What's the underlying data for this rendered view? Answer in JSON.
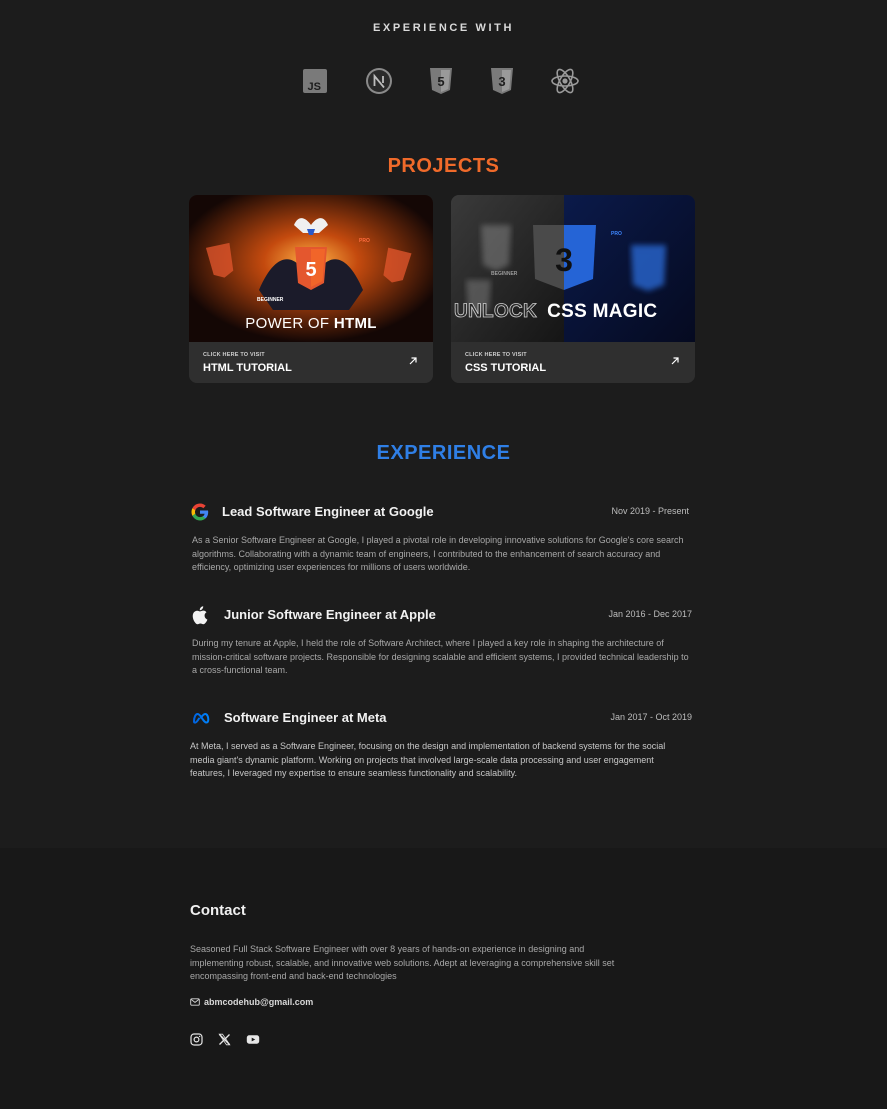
{
  "experience_with": {
    "heading": "EXPERIENCE WITH",
    "icons": [
      "javascript-icon",
      "nextjs-icon",
      "html5-icon",
      "css3-icon",
      "react-icon"
    ]
  },
  "projects": {
    "heading": "PROJECTS",
    "cards": [
      {
        "thumb_caption_a": "POWER OF ",
        "thumb_caption_b": "HTML",
        "thumb_tag_beginner": "BEGINNER",
        "thumb_tag_pro": "PRO",
        "visit_label": "CLICK HERE TO VISIT",
        "title": "HTML TUTORIAL"
      },
      {
        "thumb_caption_a": "UNLOCK",
        "thumb_caption_b": "CSS MAGIC",
        "thumb_tag_beginner": "BEGINNER",
        "thumb_tag_pro": "PRO",
        "visit_label": "CLICK HERE TO VISIT",
        "title": "CSS TUTORIAL"
      }
    ]
  },
  "experience": {
    "heading": "EXPERIENCE",
    "jobs": [
      {
        "logo": "google-logo-icon",
        "title": "Lead Software Engineer at Google",
        "date": "Nov 2019 - Present",
        "description": "As a Senior Software Engineer at Google, I played a pivotal role in developing innovative solutions for Google's core search algorithms. Collaborating with a dynamic team of engineers, I contributed to the enhancement of search accuracy and efficiency, optimizing user experiences for millions of users worldwide."
      },
      {
        "logo": "apple-logo-icon",
        "title": "Junior Software Engineer at Apple",
        "date": "Jan 2016 - Dec 2017",
        "description": "During my tenure at Apple, I held the role of Software Architect, where I played a key role in shaping the architecture of mission-critical software projects. Responsible for designing scalable and efficient systems, I provided technical leadership to a cross-functional team."
      },
      {
        "logo": "meta-logo-icon",
        "title": "Software Engineer at Meta",
        "date": "Jan 2017 - Oct 2019",
        "description": "At Meta, I served as a  Software Engineer, focusing on the design and implementation of backend systems for the social media giant's dynamic platform. Working on projects that involved large-scale data processing and user engagement features, I leveraged my expertise to ensure seamless functionality and scalability."
      }
    ]
  },
  "contact": {
    "heading": "Contact",
    "description": "Seasoned Full Stack Software Engineer with over 8 years of hands-on experience in designing and implementing robust, scalable, and innovative web solutions. Adept at leveraging a comprehensive skill set encompassing front-end and back-end technologies",
    "email": "abmcodehub@gmail.com",
    "socials": [
      "instagram-icon",
      "x-twitter-icon",
      "youtube-icon"
    ]
  },
  "colors": {
    "projects_heading": "#f06a2a",
    "experience_heading": "#2f7fe6",
    "background": "#1c1c1c",
    "footer_background": "#181818"
  }
}
